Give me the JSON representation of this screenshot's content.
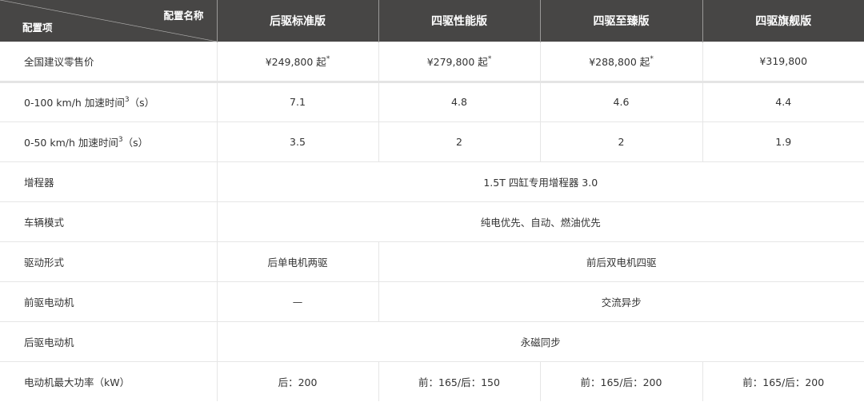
{
  "header": {
    "corner_top": "配置名称",
    "corner_bottom": "配置项",
    "variants": [
      "后驱标准版",
      "四驱性能版",
      "四驱至臻版",
      "四驱旗舰版"
    ]
  },
  "rows": {
    "price": {
      "label": "全国建议零售价",
      "values": [
        "¥249,800 起",
        "¥279,800 起",
        "¥288,800 起",
        "¥319,800"
      ],
      "footnote": "*"
    },
    "acc100": {
      "label": "0-100 km/h 加速时间",
      "sup": "3",
      "unit": "（s）",
      "values": [
        "7.1",
        "4.8",
        "4.6",
        "4.4"
      ]
    },
    "acc50": {
      "label": "0-50 km/h 加速时间",
      "sup": "3",
      "unit": "（s）",
      "values": [
        "3.5",
        "2",
        "2",
        "1.9"
      ]
    },
    "range_extender": {
      "label": "增程器",
      "value": "1.5T 四缸专用增程器 3.0"
    },
    "drive_mode": {
      "label": "车辆模式",
      "value": "纯电优先、自动、燃油优先"
    },
    "drive_type": {
      "label": "驱动形式",
      "values": [
        "后单电机两驱",
        "前后双电机四驱"
      ]
    },
    "front_motor": {
      "label": "前驱电动机",
      "values": [
        "—",
        "交流异步"
      ]
    },
    "rear_motor": {
      "label": "后驱电动机",
      "value": "永磁同步"
    },
    "max_power": {
      "label": "电动机最大功率（kW）",
      "values": [
        "后：200",
        "前：165/后：150",
        "前：165/后：200",
        "前：165/后：200"
      ]
    }
  }
}
